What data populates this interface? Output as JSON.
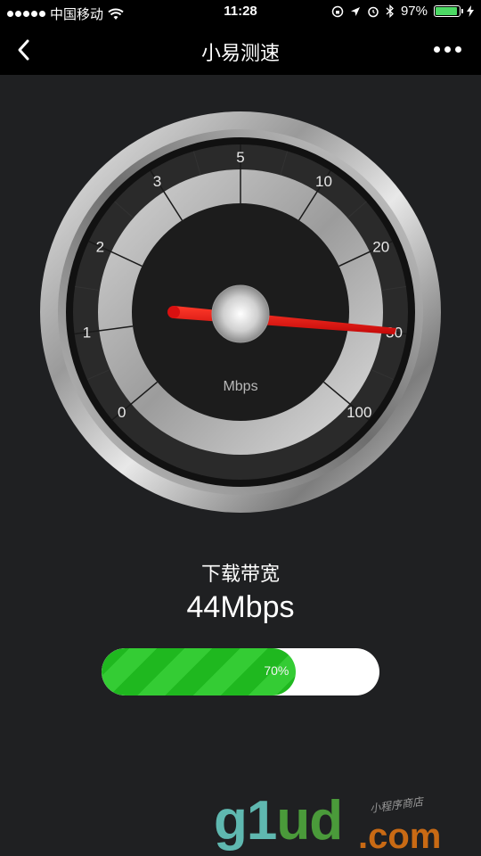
{
  "status_bar": {
    "carrier": "中国移动",
    "time": "11:28",
    "battery": "97%"
  },
  "nav": {
    "title": "小易测速"
  },
  "gauge": {
    "scale_labels": [
      "0",
      "1",
      "2",
      "3",
      "5",
      "10",
      "20",
      "30",
      "100"
    ],
    "unit": "Mbps",
    "needle_value": "30"
  },
  "result": {
    "label": "下载带宽",
    "value": "44Mbps"
  },
  "progress": {
    "percent_label": "70%",
    "fraction": 0.7
  },
  "watermark": {
    "brand_main": "g1ud",
    "brand_domain": ".com",
    "brand_sub": "小程序商店"
  },
  "colors": {
    "accent_green": "#1fb81f",
    "needle_red": "#e01010",
    "background": "#1f2022"
  }
}
